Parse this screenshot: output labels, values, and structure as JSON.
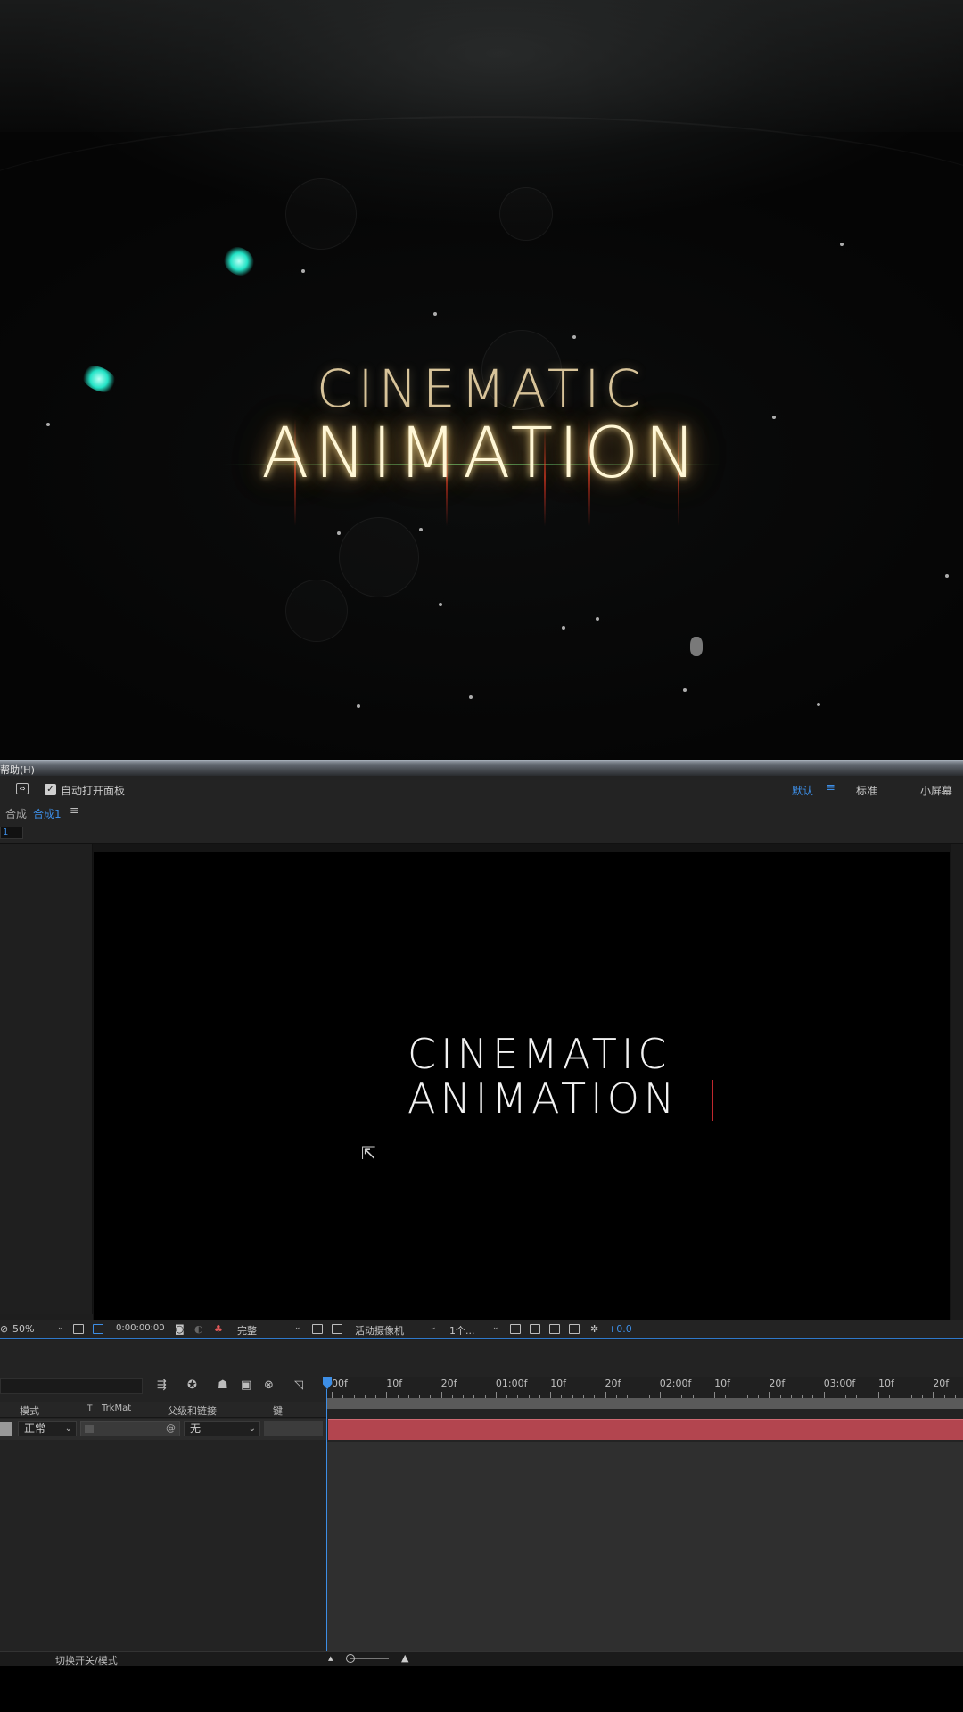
{
  "hero": {
    "title_line1": "CINEMATIC",
    "title_line2": "ANIMATION",
    "colors": {
      "gold": "#d8c49a",
      "glow": "#ffe39a",
      "cyan": "#22e3c6"
    }
  },
  "menu": {
    "help": "帮助(H)"
  },
  "toolbar": {
    "auto_open_label": "自动打开面板",
    "auto_open_checked": true,
    "workspaces": [
      {
        "label": "默认",
        "active": true
      },
      {
        "label": "标准",
        "active": false
      },
      {
        "label": "小屏幕",
        "active": false
      }
    ],
    "ws_menu_icon": "hamburger-icon"
  },
  "comp_panel": {
    "tab_prefix": "合成",
    "tab_name": "合成1",
    "sub_tab": "1",
    "viewer_line1": "CINEMATIC",
    "viewer_line2": "ANIMATION"
  },
  "viewer_bar": {
    "zoom": "50%",
    "timecode": "0:00:00:00",
    "resolution": "完整",
    "camera": "活动摄像机",
    "views": "1个...",
    "exposure": "+0.0"
  },
  "timeline": {
    "ruler_labels": [
      "00f",
      "10f",
      "20f",
      "01:00f",
      "10f",
      "20f",
      "02:00f",
      "10f",
      "20f",
      "03:00f",
      "10f",
      "20f"
    ],
    "columns": {
      "mode": "模式",
      "t": "T",
      "trkmat": "TrkMat",
      "parent": "父级和链接",
      "keys": "键"
    },
    "layer": {
      "mode": "正常",
      "parent": "无"
    },
    "layer_bar_color": "#b3454f",
    "toggle_label": "切换开关/模式"
  }
}
